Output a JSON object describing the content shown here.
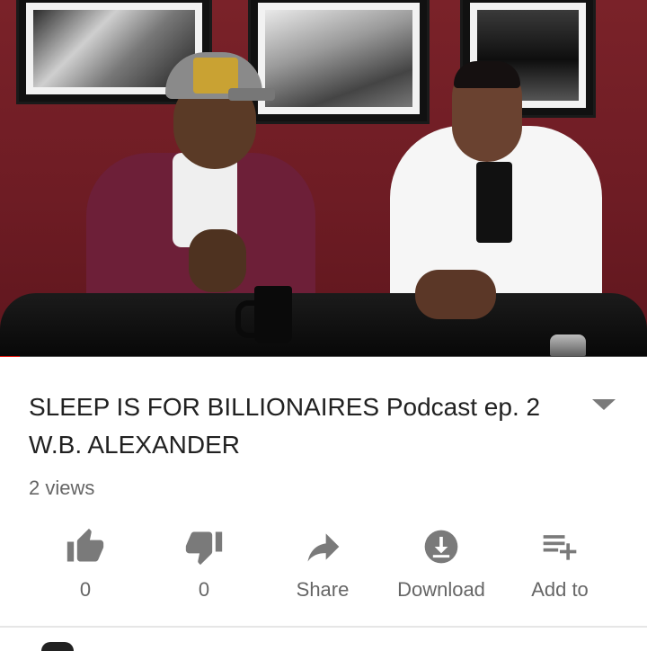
{
  "video": {
    "progress_fraction": 0.03,
    "colors": {
      "progress": "#e62117",
      "wall": "#6e1c24"
    }
  },
  "info": {
    "title": "SLEEP IS FOR BILLIONAIRES Podcast ep. 2 W.B. ALEXANDER",
    "views": "2 views",
    "expand_icon": "chevron-down-icon"
  },
  "actions": [
    {
      "icon": "thumbs-up-icon",
      "label": "0"
    },
    {
      "icon": "thumbs-down-icon",
      "label": "0"
    },
    {
      "icon": "share-icon",
      "label": "Share"
    },
    {
      "icon": "download-icon",
      "label": "Download"
    },
    {
      "icon": "add-to-playlist-icon",
      "label": "Add to"
    }
  ]
}
